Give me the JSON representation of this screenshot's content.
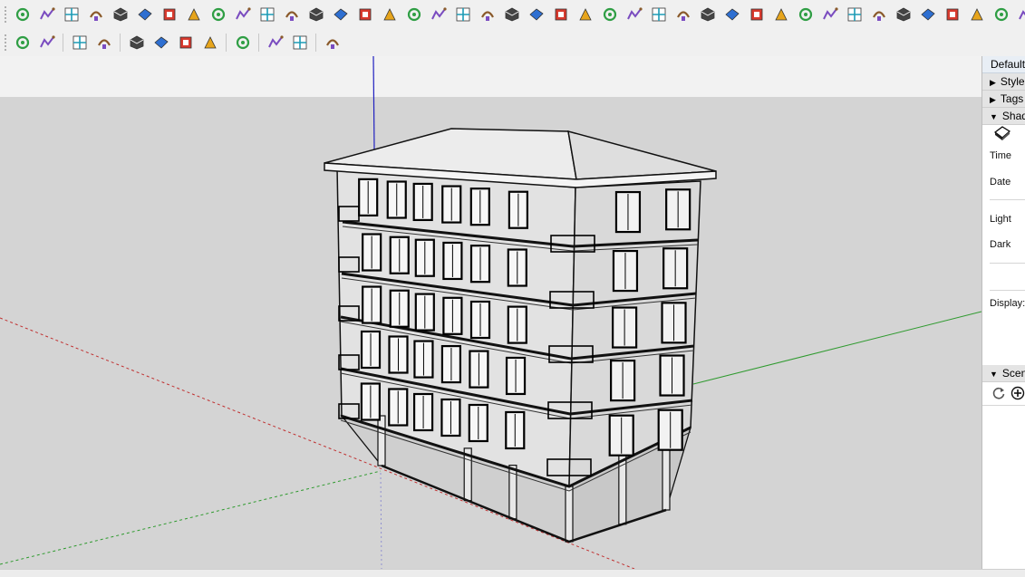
{
  "toolbars": {
    "row1": [
      "select-tool",
      "paint-bucket",
      "eraser",
      "tape-measure",
      "make-component",
      "orbit",
      "pan",
      "zoom",
      "zoom-extents",
      "previous-view",
      "line-tool",
      "freehand",
      "rectangle",
      "rotated-rectangle",
      "circle",
      "polygon",
      "arc",
      "two-point-arc",
      "three-point-arc",
      "pie",
      "move",
      "push-pull",
      "rotate",
      "follow-me",
      "scale",
      "offset",
      "dimensions",
      "protractor",
      "text",
      "axes",
      "3d-text",
      "section-plane",
      "walk",
      "look-around",
      "position-camera",
      "solid-union",
      "solid-intersect",
      "solid-subtract",
      "solid-trim",
      "solid-split",
      "outer-shell",
      "sandbox-smoove",
      "sandbox-stamp",
      "sandbox-drape",
      "sandbox-add-detail",
      "sandbox-flip-edge",
      "sandbox-from-contours",
      "sandbox-from-scratch",
      "materials",
      "components"
    ],
    "row2": [
      "extension-warehouse",
      "refresh",
      "camera",
      "add-location",
      "tree",
      "shadow-toggle",
      "checker",
      "cloud-upload",
      "settings",
      "message",
      "info",
      "plugin-tools"
    ]
  },
  "tray": {
    "title": "Default Tray",
    "panels": {
      "styles": "Styles",
      "tags": "Tags",
      "shadows": "Shadows",
      "scenes": "Scenes"
    },
    "shadows": {
      "time_label": "Time",
      "date_label": "Date",
      "light_label": "Light",
      "dark_label": "Dark",
      "display_label": "Display:"
    }
  },
  "colors": {
    "axis_red": "#c03030",
    "axis_green": "#2e9a2e",
    "axis_blue": "#2020c0",
    "sky": "#f2f2f2",
    "ground": "#d4d4d4"
  }
}
